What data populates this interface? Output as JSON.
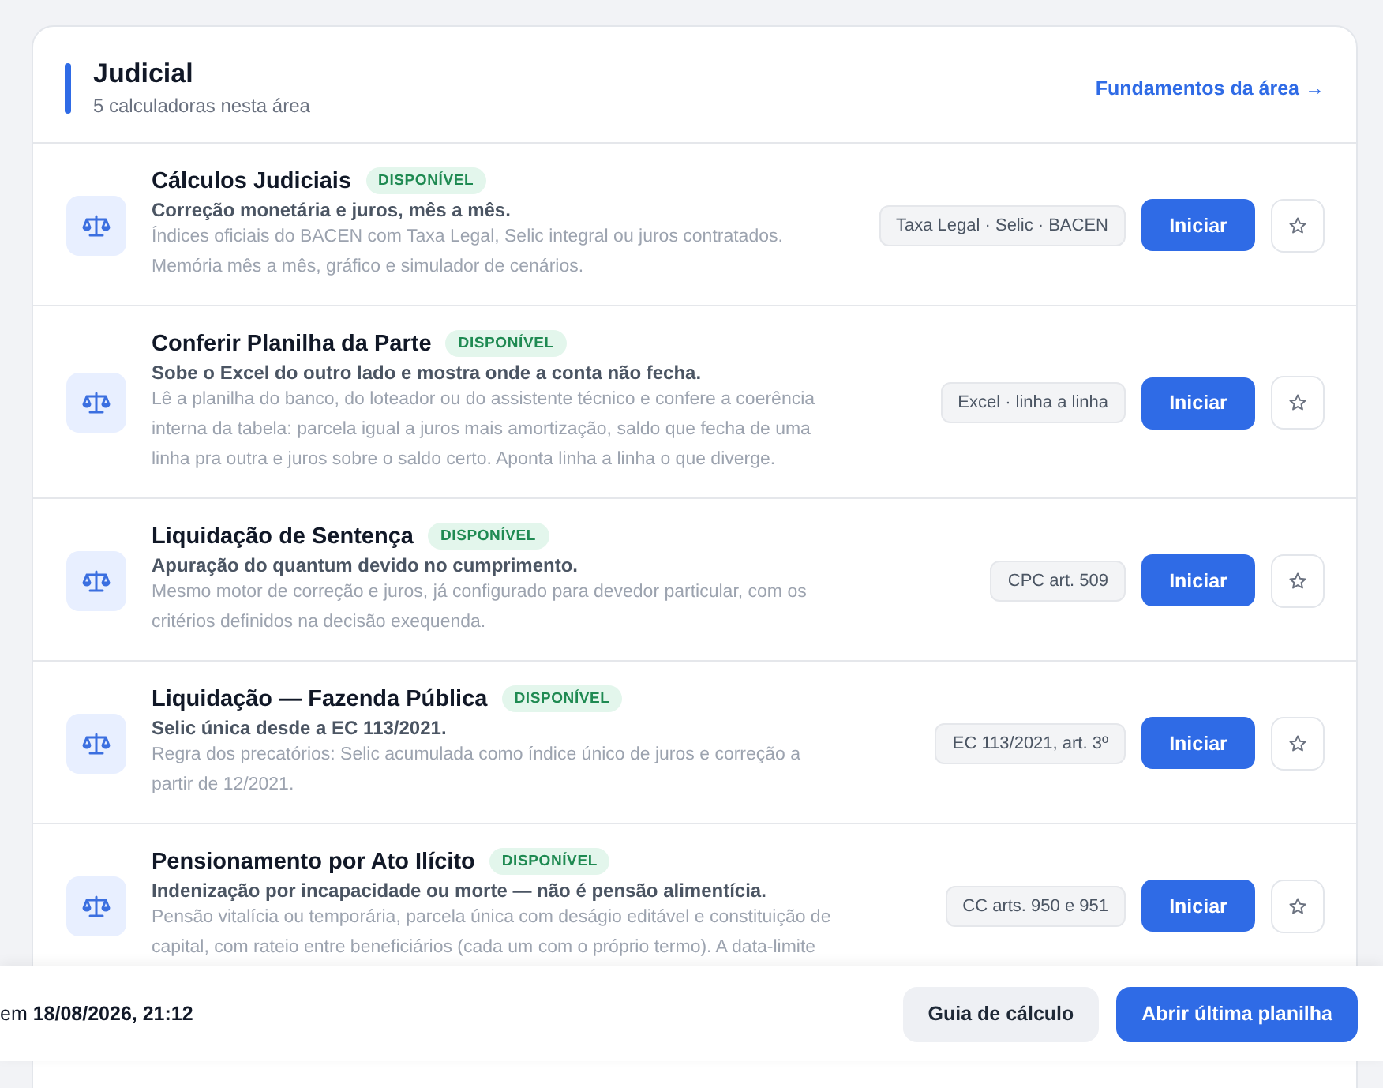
{
  "header": {
    "title": "Judicial",
    "subtitle": "5 calculadoras nesta área",
    "link": "Fundamentos da área →"
  },
  "calculators": [
    {
      "title": "Cálculos Judiciais",
      "status": "DISPONÍVEL",
      "summary": "Correção monetária e juros, mês a mês.",
      "description": [
        "Índices oficiais do BACEN com Taxa Legal, Selic integral ou juros contratados.",
        "Memória mês a mês, gráfico e simulador de cenários."
      ],
      "tag": "Taxa Legal · Selic · BACEN",
      "action": "Iniciar",
      "favorite": false
    },
    {
      "title": "Conferir Planilha da Parte",
      "status": "DISPONÍVEL",
      "summary": "Sobe o Excel do outro lado e mostra onde a conta não fecha.",
      "description": [
        "Lê a planilha do banco, do loteador ou do assistente técnico e confere a coerência",
        "interna da tabela: parcela igual a juros mais amortização, saldo que fecha de uma",
        "linha pra outra e juros sobre o saldo certo. Aponta linha a linha o que diverge."
      ],
      "tag": "Excel · linha a linha",
      "action": "Iniciar",
      "favorite": false
    },
    {
      "title": "Liquidação de Sentença",
      "status": "DISPONÍVEL",
      "summary": "Apuração do quantum devido no cumprimento.",
      "description": [
        "Mesmo motor de correção e juros, já configurado para devedor particular, com os",
        "critérios definidos na decisão exequenda."
      ],
      "tag": "CPC art. 509",
      "action": "Iniciar",
      "favorite": false
    },
    {
      "title": "Liquidação — Fazenda Pública",
      "status": "DISPONÍVEL",
      "summary": "Selic única desde a EC 113/2021.",
      "description": [
        "Regra dos precatórios: Selic acumulada como índice único de juros e correção a",
        "partir de 12/2021."
      ],
      "tag": "EC 113/2021, art. 3º",
      "action": "Iniciar",
      "favorite": false
    },
    {
      "title": "Pensionamento por Ato Ilícito",
      "status": "DISPONÍVEL",
      "summary": "Indenização por incapacidade ou morte — não é pensão alimentícia.",
      "description": [
        "Pensão vitalícia ou temporária, parcela única com deságio editável e constituição de",
        "capital, com rateio entre beneficiários (cada um com o próprio termo). A data-limite"
      ],
      "tag": "CC arts. 950 e 951",
      "action": "Iniciar",
      "favorite": false
    }
  ],
  "footer": {
    "saved": "em **18/08/2026, 21:12**",
    "buttons": [
      {
        "label": "Guia de cálculo",
        "kind": "secondary"
      },
      {
        "label": "Abrir última planilha",
        "kind": "primary"
      }
    ]
  }
}
